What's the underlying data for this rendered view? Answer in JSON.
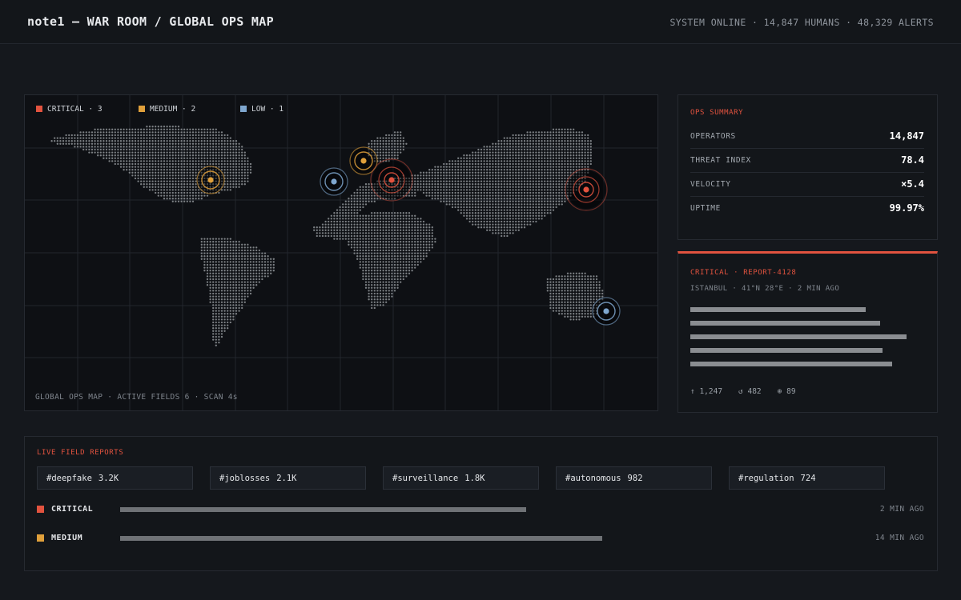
{
  "header": {
    "title": "note1 — WAR ROOM / GLOBAL OPS MAP",
    "status": "SYSTEM ONLINE · 14,847 HUMANS · 48,329 ALERTS"
  },
  "map": {
    "legend": [
      {
        "label": "CRITICAL · 3",
        "color": "#e2533f"
      },
      {
        "label": "MEDIUM · 2",
        "color": "#e0a03b"
      },
      {
        "label": "LOW · 1",
        "color": "#7fa7cf"
      }
    ],
    "footer": "GLOBAL OPS MAP · ACTIVE FIELDS 6 · SCAN 4s",
    "markers": [
      {
        "severity": "medium"
      },
      {
        "severity": "medium"
      },
      {
        "severity": "low"
      },
      {
        "severity": "critical"
      },
      {
        "severity": "critical"
      },
      {
        "severity": "low"
      }
    ]
  },
  "ops_summary": {
    "title": "OPS SUMMARY",
    "rows": [
      {
        "label": "OPERATORS",
        "value": "14,847"
      },
      {
        "label": "THREAT INDEX",
        "value": "78.4"
      },
      {
        "label": "VELOCITY",
        "value": "×5.4"
      },
      {
        "label": "UPTIME",
        "value": "99.97%"
      }
    ]
  },
  "report": {
    "title": "CRITICAL · REPORT-4128",
    "meta": "ISTANBUL · 41°N 28°E · 2 MIN AGO",
    "upvotes": "↑ 1,247",
    "reposts": "↺ 482",
    "views": "⊕ 89"
  },
  "live": {
    "title": "LIVE FIELD REPORTS",
    "tags": [
      {
        "tag": "#deepfake",
        "count": "3.2K"
      },
      {
        "tag": "#joblosses",
        "count": "2.1K"
      },
      {
        "tag": "#surveillance",
        "count": "1.8K"
      },
      {
        "tag": "#autonomous",
        "count": "982"
      },
      {
        "tag": "#regulation",
        "count": "724"
      }
    ],
    "rows": [
      {
        "label": "CRITICAL",
        "color": "#e2533f",
        "level": 0.48,
        "time": "2 MIN AGO"
      },
      {
        "label": "MEDIUM",
        "color": "#e0a03b",
        "level": 0.57,
        "time": "14 MIN AGO"
      }
    ]
  },
  "colors": {
    "critical": "#e2533f",
    "medium": "#e0a03b",
    "low": "#7fa7cf"
  }
}
